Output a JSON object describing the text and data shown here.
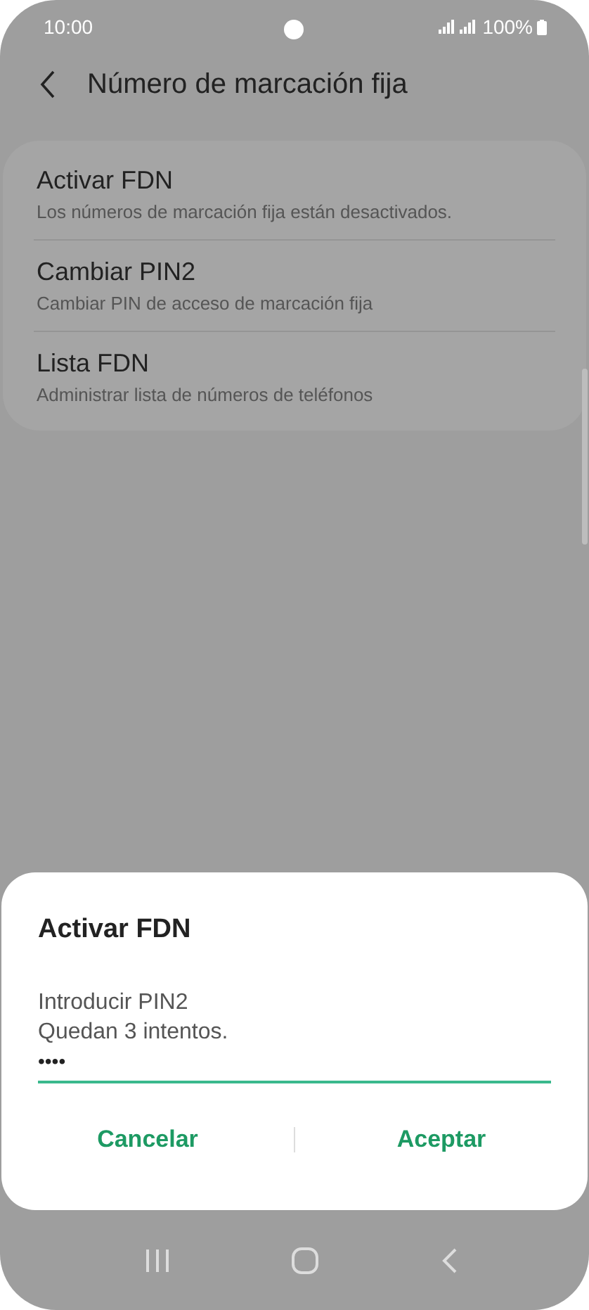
{
  "status_bar": {
    "time": "10:00",
    "battery": "100%"
  },
  "header": {
    "title": "Número de marcación fija"
  },
  "settings": [
    {
      "title": "Activar FDN",
      "subtitle": "Los números de marcación fija están desactivados."
    },
    {
      "title": "Cambiar PIN2",
      "subtitle": "Cambiar PIN de acceso de marcación fija"
    },
    {
      "title": "Lista FDN",
      "subtitle": "Administrar lista de números de teléfonos"
    }
  ],
  "dialog": {
    "title": "Activar FDN",
    "message_lines": [
      "Introducir PIN2",
      "Quedan 3 intentos."
    ],
    "pin_value": "••••",
    "buttons": [
      "Cancelar",
      "Aceptar"
    ]
  }
}
